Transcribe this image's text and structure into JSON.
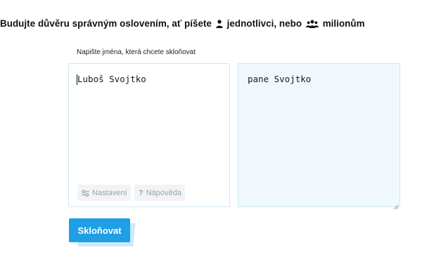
{
  "headline": {
    "part1": "Budujte důvěru správným oslovením, ať píšete",
    "part2": "jednotlivci, nebo",
    "part3": "milionům",
    "icon_single": "person-icon",
    "icon_group": "group-icon"
  },
  "form": {
    "instruction": "Napište jména, která chcete skloňovat",
    "input_value": "Luboš Svojtko",
    "settings_label": "Nastavení",
    "settings_icon": "sliders-icon",
    "help_label": "Nápověda",
    "help_icon": "question-icon",
    "output_value": "pane Svojtko",
    "submit_label": "Skloňovat"
  },
  "colors": {
    "accent": "#1f9fe6",
    "panel_border": "#cfe7f3",
    "output_bg": "#f0f8fc",
    "chip_bg": "#f1f3f5",
    "chip_text": "#9aa3ab"
  }
}
